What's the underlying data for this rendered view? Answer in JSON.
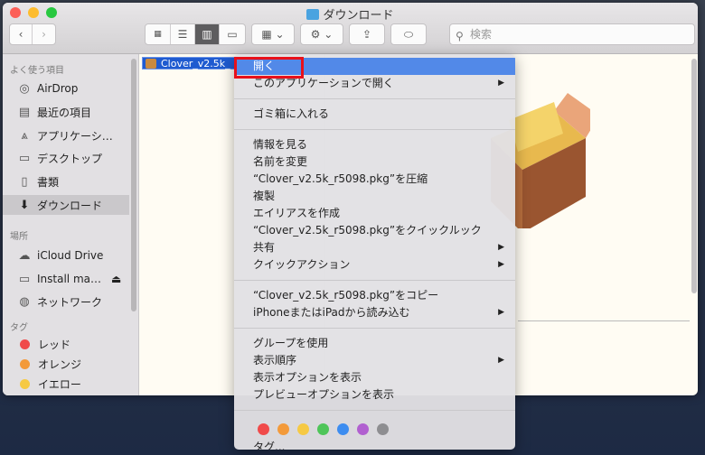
{
  "window": {
    "title": "ダウンロード"
  },
  "toolbar": {
    "search_placeholder": "検索"
  },
  "sidebar": {
    "favorites_header": "よく使う項目",
    "favorites": [
      {
        "label": "AirDrop",
        "icon": "airdrop-icon"
      },
      {
        "label": "最近の項目",
        "icon": "recents-icon"
      },
      {
        "label": "アプリケーシ…",
        "icon": "applications-icon"
      },
      {
        "label": "デスクトップ",
        "icon": "desktop-icon"
      },
      {
        "label": "書類",
        "icon": "documents-icon"
      },
      {
        "label": "ダウンロード",
        "icon": "downloads-icon"
      }
    ],
    "locations_header": "場所",
    "locations": [
      {
        "label": "iCloud Drive",
        "icon": "cloud-icon"
      },
      {
        "label": "Install ma…",
        "icon": "disk-icon"
      },
      {
        "label": "ネットワーク",
        "icon": "network-icon"
      }
    ],
    "tags_header": "タグ",
    "tags": [
      {
        "label": "レッド",
        "color": "#f04a4a"
      },
      {
        "label": "オレンジ",
        "color": "#f39a3a"
      },
      {
        "label": "イエロー",
        "color": "#f6c944"
      }
    ]
  },
  "file": {
    "name": "Clover_v2.5k_"
  },
  "menu": {
    "items": [
      "開く",
      "このアプリケーションで開く",
      "ゴミ箱に入れる",
      "情報を見る",
      "名前を変更",
      "“Clover_v2.5k_r5098.pkg”を圧縮",
      "複製",
      "エイリアスを作成",
      "“Clover_v2.5k_r5098.pkg”をクイックルック",
      "共有",
      "クイックアクション",
      "“Clover_v2.5k_r5098.pkg”をコピー",
      "iPhoneまたはiPadから読み込む",
      "グループを使用",
      "表示順序",
      "表示オプションを表示",
      "プレビューオプションを表示",
      "タグ..."
    ],
    "tag_colors": [
      "#f04a4a",
      "#f39a3a",
      "#f6c944",
      "#4ec559",
      "#3d8df0",
      "#b160d0",
      "#8e8e91"
    ]
  }
}
